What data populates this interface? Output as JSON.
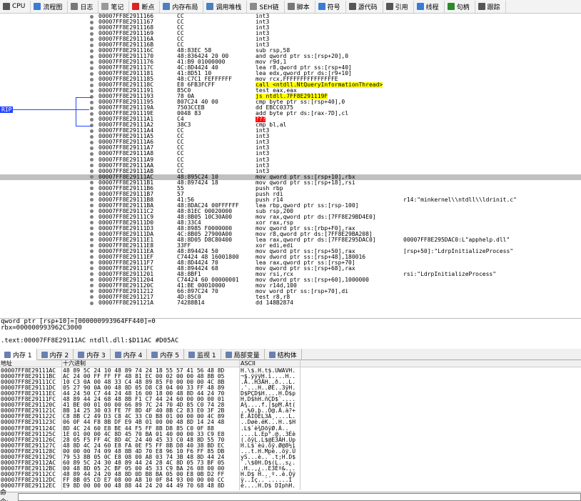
{
  "toolbar": [
    {
      "label": "CPU",
      "icon": "cpu-icon",
      "color": "#555555"
    },
    {
      "label": "流程图",
      "icon": "graph-icon",
      "color": "#3a7bd5"
    },
    {
      "label": "日志",
      "icon": "log-icon",
      "color": "#777777"
    },
    {
      "label": "笔记",
      "icon": "notes-icon",
      "color": "#999999"
    },
    {
      "label": "断点",
      "icon": "breakpoint-icon",
      "color": "#dd2222"
    },
    {
      "label": "内存布局",
      "icon": "memory-map-icon",
      "color": "#4a7fc0"
    },
    {
      "label": "调用堆栈",
      "icon": "call-stack-icon",
      "color": "#4a7fc0"
    },
    {
      "label": "SEH链",
      "icon": "seh-icon",
      "color": "#8a8a8a"
    },
    {
      "label": "脚本",
      "icon": "script-icon",
      "color": "#777777"
    },
    {
      "label": "符号",
      "icon": "symbols-icon",
      "color": "#3a7bd5"
    },
    {
      "label": "源代码",
      "icon": "source-icon",
      "color": "#555555"
    },
    {
      "label": "引用",
      "icon": "references-icon",
      "color": "#555555"
    },
    {
      "label": "线程",
      "icon": "threads-icon",
      "color": "#3a7bd5"
    },
    {
      "label": "句柄",
      "icon": "handles-icon",
      "color": "#2a8a2a"
    },
    {
      "label": "跟踪",
      "icon": "trace-icon",
      "color": "#555555"
    }
  ],
  "rip_label": "RIP",
  "disasm": [
    {
      "addr": "00007FF8E2911166",
      "bytes": "CC",
      "ins": "int3"
    },
    {
      "addr": "00007FF8E2911167",
      "bytes": "CC",
      "ins": "int3"
    },
    {
      "addr": "00007FF8E2911168",
      "bytes": "CC",
      "ins": "int3"
    },
    {
      "addr": "00007FF8E2911169",
      "bytes": "CC",
      "ins": "int3"
    },
    {
      "addr": "00007FF8E291116A",
      "bytes": "CC",
      "ins": "int3"
    },
    {
      "addr": "00007FF8E291116B",
      "bytes": "CC",
      "ins": "int3"
    },
    {
      "addr": "00007FF8E291116C",
      "bytes": "48:83EC 58",
      "ins": "sub rsp,58"
    },
    {
      "addr": "00007FF8E2911170",
      "bytes": "48:836424 20 00",
      "ins": "and qword ptr ss:[rsp+20],0"
    },
    {
      "addr": "00007FF8E2911176",
      "bytes": "41:B9 01000000",
      "ins": "mov r9d,1"
    },
    {
      "addr": "00007FF8E291117C",
      "bytes": "4C:8D4424 40",
      "ins": "lea r8,qword ptr ss:[rsp+40]"
    },
    {
      "addr": "00007FF8E2911181",
      "bytes": "41:8D51 10",
      "ins": "lea edx,qword ptr ds:[r9+10]"
    },
    {
      "addr": "00007FF8E2911185",
      "bytes": "48:C7C1 FEFFFFFF",
      "ins": "mov rcx,FFFFFFFFFFFFFFFE"
    },
    {
      "addr": "00007FF8E291118C",
      "bytes": "E8 6FB3FCFF",
      "ins": "call <ntdll.NtQueryInformationThread>",
      "style": "call"
    },
    {
      "addr": "00007FF8E2911191",
      "bytes": "85C0",
      "ins": "test eax,eax"
    },
    {
      "addr": "00007FF8E2911193",
      "bytes": "78 0A",
      "ins": "js ntdll.7FF8E291119F",
      "style": "jump"
    },
    {
      "addr": "00007FF8E2911195",
      "bytes": "807C24 40 00",
      "ins": "cmp byte ptr ss:[rsp+40],0"
    },
    {
      "addr": "00007FF8E291119A",
      "bytes": "7503CCEB",
      "ins": "dd EBCC0375"
    },
    {
      "addr": "00007FF8E291119E",
      "bytes": "0048 83",
      "ins": "add byte ptr ds:[rax-7D],cl"
    },
    {
      "addr": "00007FF8E29111A1",
      "bytes": "C4",
      "ins": "???",
      "style": "bad"
    },
    {
      "addr": "00007FF8E29111A2",
      "bytes": "38C3",
      "ins": "cmp bl,al"
    },
    {
      "addr": "00007FF8E29111A4",
      "bytes": "CC",
      "ins": "int3"
    },
    {
      "addr": "00007FF8E29111A5",
      "bytes": "CC",
      "ins": "int3"
    },
    {
      "addr": "00007FF8E29111A6",
      "bytes": "CC",
      "ins": "int3"
    },
    {
      "addr": "00007FF8E29111A7",
      "bytes": "CC",
      "ins": "int3"
    },
    {
      "addr": "00007FF8E29111A8",
      "bytes": "CC",
      "ins": "int3"
    },
    {
      "addr": "00007FF8E29111A9",
      "bytes": "CC",
      "ins": "int3"
    },
    {
      "addr": "00007FF8E29111AA",
      "bytes": "CC",
      "ins": "int3"
    },
    {
      "addr": "00007FF8E29111AB",
      "bytes": "CC",
      "ins": "int3"
    },
    {
      "addr": "00007FF8E29111AC",
      "bytes": "48:895C24 10",
      "ins": "mov qword ptr ss:[rsp+10],rbx",
      "sel": true
    },
    {
      "addr": "00007FF8E29111B1",
      "bytes": "48:897424 18",
      "ins": "mov qword ptr ss:[rsp+18],rsi"
    },
    {
      "addr": "00007FF8E29111B6",
      "bytes": "55",
      "ins": "push rbp"
    },
    {
      "addr": "00007FF8E29111B7",
      "bytes": "57",
      "ins": "push rdi"
    },
    {
      "addr": "00007FF8E29111B8",
      "bytes": "41:56",
      "ins": "push r14",
      "cmt": "r14:\"minkernel\\\\ntdll\\\\ldrinit.c\""
    },
    {
      "addr": "00007FF8E29111BA",
      "bytes": "48:8DAC24 00FFFFFF",
      "ins": "lea rbp,qword ptr ss:[rsp-100]"
    },
    {
      "addr": "00007FF8E29111C2",
      "bytes": "48:81EC 00020000",
      "ins": "sub rsp,200"
    },
    {
      "addr": "00007FF8E29111C9",
      "bytes": "48:8B05 10C30A00",
      "ins": "mov rax,qword ptr ds:[7FF8E29BD4E0]"
    },
    {
      "addr": "00007FF8E29111D0",
      "bytes": "48:33C4",
      "ins": "xor rax,rsp"
    },
    {
      "addr": "00007FF8E29111D3",
      "bytes": "48:8985 F0000000",
      "ins": "mov qword ptr ss:[rbp+F0],rax"
    },
    {
      "addr": "00007FF8E29111DA",
      "bytes": "4C:8B05 27900A00",
      "ins": "mov r8,qword ptr ds:[7FF8E29BA208]"
    },
    {
      "addr": "00007FF8E29111E1",
      "bytes": "48:8D05 D8C80400",
      "ins": "lea rax,qword ptr ds:[7FF8E295DAC0]",
      "cmt": "00007FF8E295DAC0:L\"apphelp.dll\""
    },
    {
      "addr": "00007FF8E29111E8",
      "bytes": "33FF",
      "ins": "xor edi,edi"
    },
    {
      "addr": "00007FF8E29111EA",
      "bytes": "48:894424 50",
      "ins": "mov qword ptr ss:[rsp+50],rax",
      "cmt": "[rsp+50]:\"LdrpInitializeProcess\""
    },
    {
      "addr": "00007FF8E29111EF",
      "bytes": "C74424 48 16001800",
      "ins": "mov dword ptr ss:[rsp+48],180016"
    },
    {
      "addr": "00007FF8E29111F7",
      "bytes": "48:8D4424 70",
      "ins": "lea rax,qword ptr ss:[rsp+70]"
    },
    {
      "addr": "00007FF8E29111FC",
      "bytes": "48:894424 68",
      "ins": "mov qword ptr ss:[rsp+68],rax"
    },
    {
      "addr": "00007FF8E2911201",
      "bytes": "48:8BF1",
      "ins": "mov rsi,rcx",
      "cmt": "rsi:\"LdrpInitializeProcess\""
    },
    {
      "addr": "00007FF8E2911204",
      "bytes": "C74424 60 00000001",
      "ins": "mov dword ptr ss:[rsp+60],1000000"
    },
    {
      "addr": "00007FF8E291120C",
      "bytes": "41:BE 00010000",
      "ins": "mov r14d,100"
    },
    {
      "addr": "00007FF8E2911212",
      "bytes": "66:897C24 70",
      "ins": "mov word ptr ss:[rsp+70],di"
    },
    {
      "addr": "00007FF8E2911217",
      "bytes": "4D:85C0",
      "ins": "test r8,r8"
    },
    {
      "addr": "00007FF8E291121A",
      "bytes": "74288B14",
      "ins": "dd 148B2874"
    }
  ],
  "info_lines": [
    "qword ptr [rsp+10]=[000000993964FF440]=0",
    "rbx=000000993962C3000",
    "",
    ".text:00007FF8E29111AC ntdll.dll:$D11AC #D05AC"
  ],
  "tabs": [
    {
      "label": "内存 1",
      "icon": "memory-icon",
      "active": true
    },
    {
      "label": "内存 2",
      "icon": "memory-icon"
    },
    {
      "label": "内存 3",
      "icon": "memory-icon"
    },
    {
      "label": "内存 4",
      "icon": "memory-icon"
    },
    {
      "label": "内存 5",
      "icon": "memory-icon"
    },
    {
      "label": "监视 1",
      "icon": "watch-icon"
    },
    {
      "label": "局部变量",
      "icon": "locals-icon"
    },
    {
      "label": "结构体",
      "icon": "struct-icon"
    }
  ],
  "dump_header": {
    "addr": "地址",
    "hex": "十六进制",
    "ascii": "ASCII"
  },
  "dump": [
    {
      "a": "00007FF8E29111AC",
      "h": "48 89 5C 24 10 48 89 74 24 18 55 57 41 56 48 8D",
      "s": "H.\\$.H.t$.UWAVH."
    },
    {
      "a": "00007FF8E29111BC",
      "h": "AC 24 00 FF FF FF 48 81 EC 00 02 00 00 48 8B 05",
      "s": "¬$.ÿÿÿH.ì....H.."
    },
    {
      "a": "00007FF8E29111CC",
      "h": "10 C3 0A 00 48 33 C4 48 89 85 F0 00 00 00 4C 8B",
      "s": ".Ã..H3ÄH..ð...L."
    },
    {
      "a": "00007FF8E29111DC",
      "h": "05 27 90 0A 00 48 8D 05 D8 C8 04 00 33 FF 48 89",
      "s": ".'...H..ØÈ..3ÿH."
    },
    {
      "a": "00007FF8E29111EC",
      "h": "44 24 50 C7 44 24 48 16 00 18 00 48 8D 44 24 70",
      "s": "D$PÇD$H....H.D$p"
    },
    {
      "a": "00007FF8E29111FC",
      "h": "48 89 44 24 68 48 8B F1 C7 44 24 60 00 00 00 01",
      "s": "H.D$hH.ñÇD$`...."
    },
    {
      "a": "00007FF8E291120C",
      "h": "41 BE 00 01 00 00 66 89 7C 24 70 4D 85 C0 74 28",
      "s": "A¾....f.|$pM.Àt("
    },
    {
      "a": "00007FF8E291121C",
      "h": "8B 14 25 30 03 FE 7F 8D 4F 40 8B C2 83 E0 3F 2B",
      "s": "..%0.þ..O@.Â.à?+"
    },
    {
      "a": "00007FF8E291122C",
      "h": "C8 8B C2 49 D3 C8 4C 33 C0 B8 01 00 00 00 4C 89",
      "s": "È.ÂIÓÈL3À¸....L."
    },
    {
      "a": "00007FF8E291123C",
      "h": "06 0F 44 F8 8B DF E9 4B 01 00 00 48 8D 14 24 48",
      "s": "..Døè.éK...H..$H"
    },
    {
      "a": "00007FF8E291124C",
      "h": "8D 4C 24 60 E8 BE 44 F5 FF 8B D8 85 C0 0F 88",
      "s": ".L$`è¾DõÿØ.À.."
    },
    {
      "a": "00007FF8E291125C",
      "h": "1E 01 00 00 4C 8D 45 70 BA 01 40 00 00 33 C9 E8",
      "s": "....L.Ep°.@..3Éè"
    },
    {
      "a": "00007FF8E291126C",
      "h": "28 05 F5 FF 4C 8D 4C 24 40 45 33 C0 48 8D 55 70",
      "s": "(.õÿL.L$@E3ÀH.Up"
    },
    {
      "a": "00007FF8E291127C",
      "h": "48 8D 4C 24 60 E8 FA 0E F5 FF 8B D8 40 38 BD EC",
      "s": "H.L$`èú.õÿ.Ø@8½ì"
    },
    {
      "a": "00007FF8E291128C",
      "h": "00 00 00 74 09 48 8B 4D 70 E8 96 10 F6 FF 85 DB",
      "s": "...t.H.Mpè..öÿ.Û"
    },
    {
      "a": "00007FF8E291129C",
      "h": "79 53 8B 05 0C E8 08 00 A8 03 74 3B 48 8D 44 24",
      "s": "yS...è..¨.t;H.D$"
    },
    {
      "a": "00007FF8E29112AC",
      "h": "60 89 5C 24 30 48 89 44 24 28 4C 8D 05 73 BF 05",
      "s": "`.\\$0H.D$(L..s¿."
    },
    {
      "a": "00007FF8E29112BC",
      "h": "00 48 8D 05 2C BF 05 00 45 33 C9 BA 26 08 00 00",
      "s": ".H..,¿..E3Éº&..."
    },
    {
      "a": "00007FF8E29112CC",
      "h": "48 89 44 24 20 48 8D 0D B8 BA 05 00 E8 0B D2 FF",
      "s": "H.D$ H..¸º..è.Òÿ"
    },
    {
      "a": "00007FF8E29112DC",
      "h": "FF 8B 05 CD E7 08 00 A8 10 0F 84 93 00 00 00 CC",
      "s": "ÿ..Íç..¨......Ì"
    },
    {
      "a": "00007FF8E29112EC",
      "h": "E9 8D 00 00 00 48 88 44 24 20 44 49 70 68 48 8D",
      "s": "é....H.D$ DIphH."
    }
  ],
  "command_label": "命令:",
  "command_value": ""
}
